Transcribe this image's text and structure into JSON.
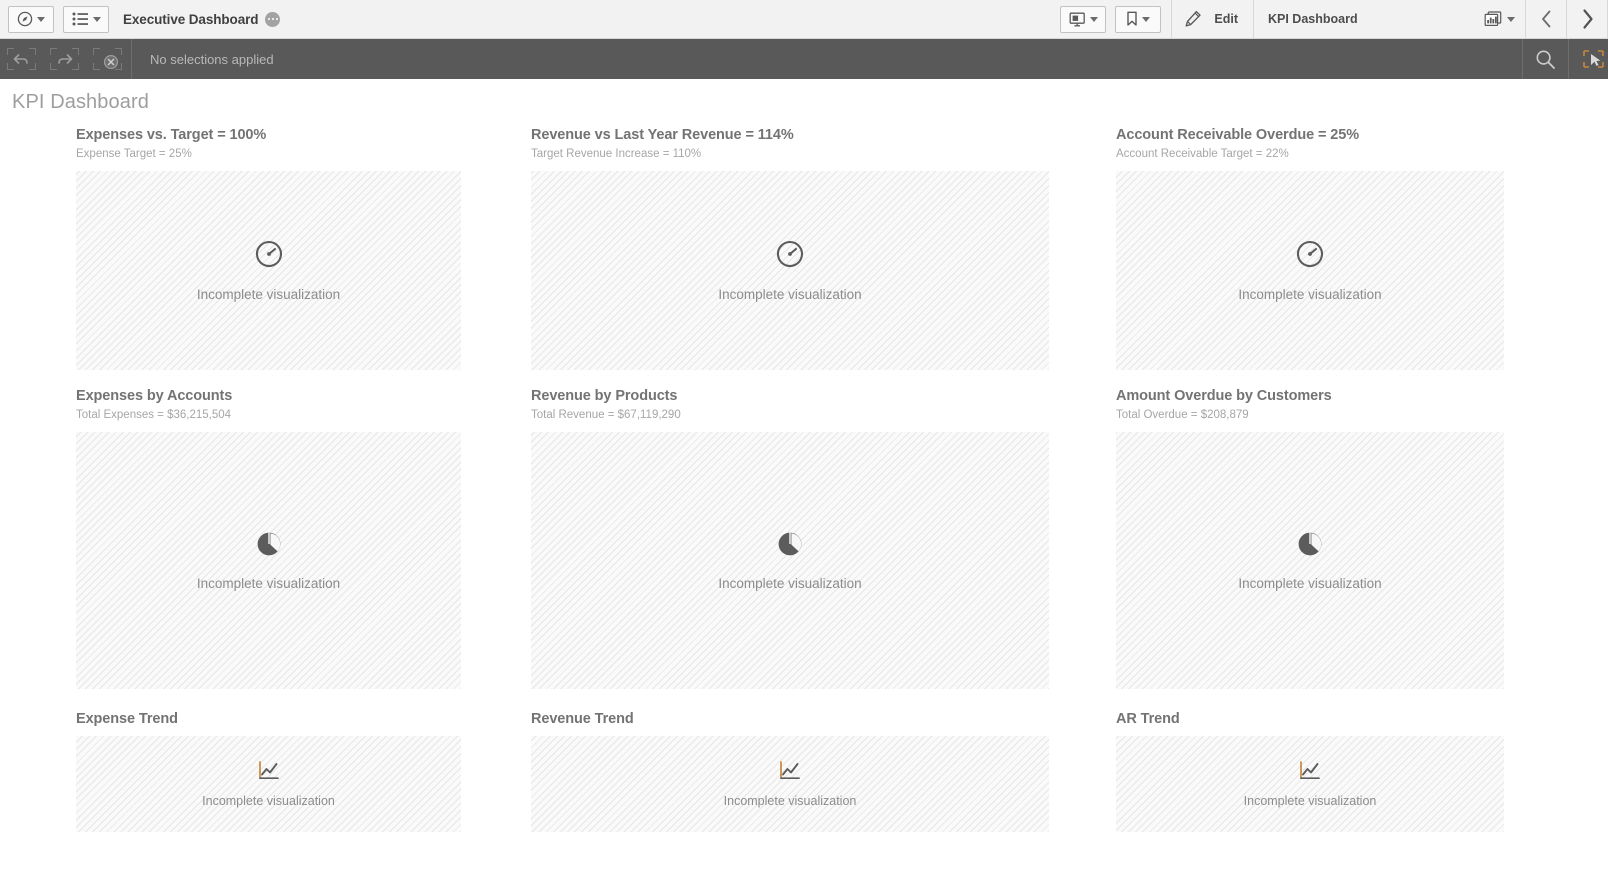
{
  "topnav": {
    "compass_icon": "compass-icon",
    "sheets_icon": "sheet-list-icon",
    "app_title": "Executive Dashboard",
    "app_info_icon": "app-info-icon",
    "story_icon": "storytelling-icon",
    "bookmark_icon": "bookmark-icon",
    "edit_icon": "pencil-edit-icon",
    "edit_label": "Edit",
    "sheet_name": "KPI Dashboard",
    "sheet_icon": "sheet-thumbnail-icon",
    "prev_icon": "chevron-left-icon",
    "next_icon": "chevron-right-icon"
  },
  "selections": {
    "step_back_icon": "step-back-icon",
    "step_forward_icon": "step-forward-icon",
    "clear_icon": "clear-selections-icon",
    "status": "No selections applied",
    "search_icon": "search-icon",
    "selections_icon": "selections-tool-icon"
  },
  "sheet": {
    "title": "KPI Dashboard",
    "placeholder_text": "Incomplete visualization",
    "columns": [
      {
        "gauge": {
          "title": "Expenses vs. Target = 100%",
          "subtitle": "Expense Target = 25%",
          "icon": "gauge-icon"
        },
        "pie": {
          "title": "Expenses by Accounts",
          "subtitle": "Total Expenses = $36,215,504",
          "icon": "pie-chart-icon"
        },
        "trend": {
          "title": "Expense Trend",
          "icon": "line-chart-icon"
        }
      },
      {
        "gauge": {
          "title": "Revenue vs Last Year Revenue = 114%",
          "subtitle": "Target Revenue Increase = 110%",
          "icon": "gauge-icon"
        },
        "pie": {
          "title": "Revenue by Products",
          "subtitle": "Total Revenue = $67,119,290",
          "icon": "pie-chart-icon"
        },
        "trend": {
          "title": "Revenue Trend",
          "icon": "line-chart-icon"
        }
      },
      {
        "gauge": {
          "title": "Account Receivable Overdue = 25%",
          "subtitle": "Account Receivable Target = 22%",
          "icon": "gauge-icon"
        },
        "pie": {
          "title": "Amount Overdue by Customers",
          "subtitle": "Total Overdue = $208,879",
          "icon": "pie-chart-icon"
        },
        "trend": {
          "title": "AR Trend",
          "icon": "line-chart-icon"
        }
      }
    ]
  },
  "colors": {
    "selection_bar": "#595959",
    "nav_bar": "#f2f2f2",
    "title_text": "#737373",
    "subtitle_text": "#a6a6a6",
    "placeholder_bg": "#f7f7f7",
    "icon_dark": "#5c5c5c",
    "icon_accent": "#c8873f"
  }
}
